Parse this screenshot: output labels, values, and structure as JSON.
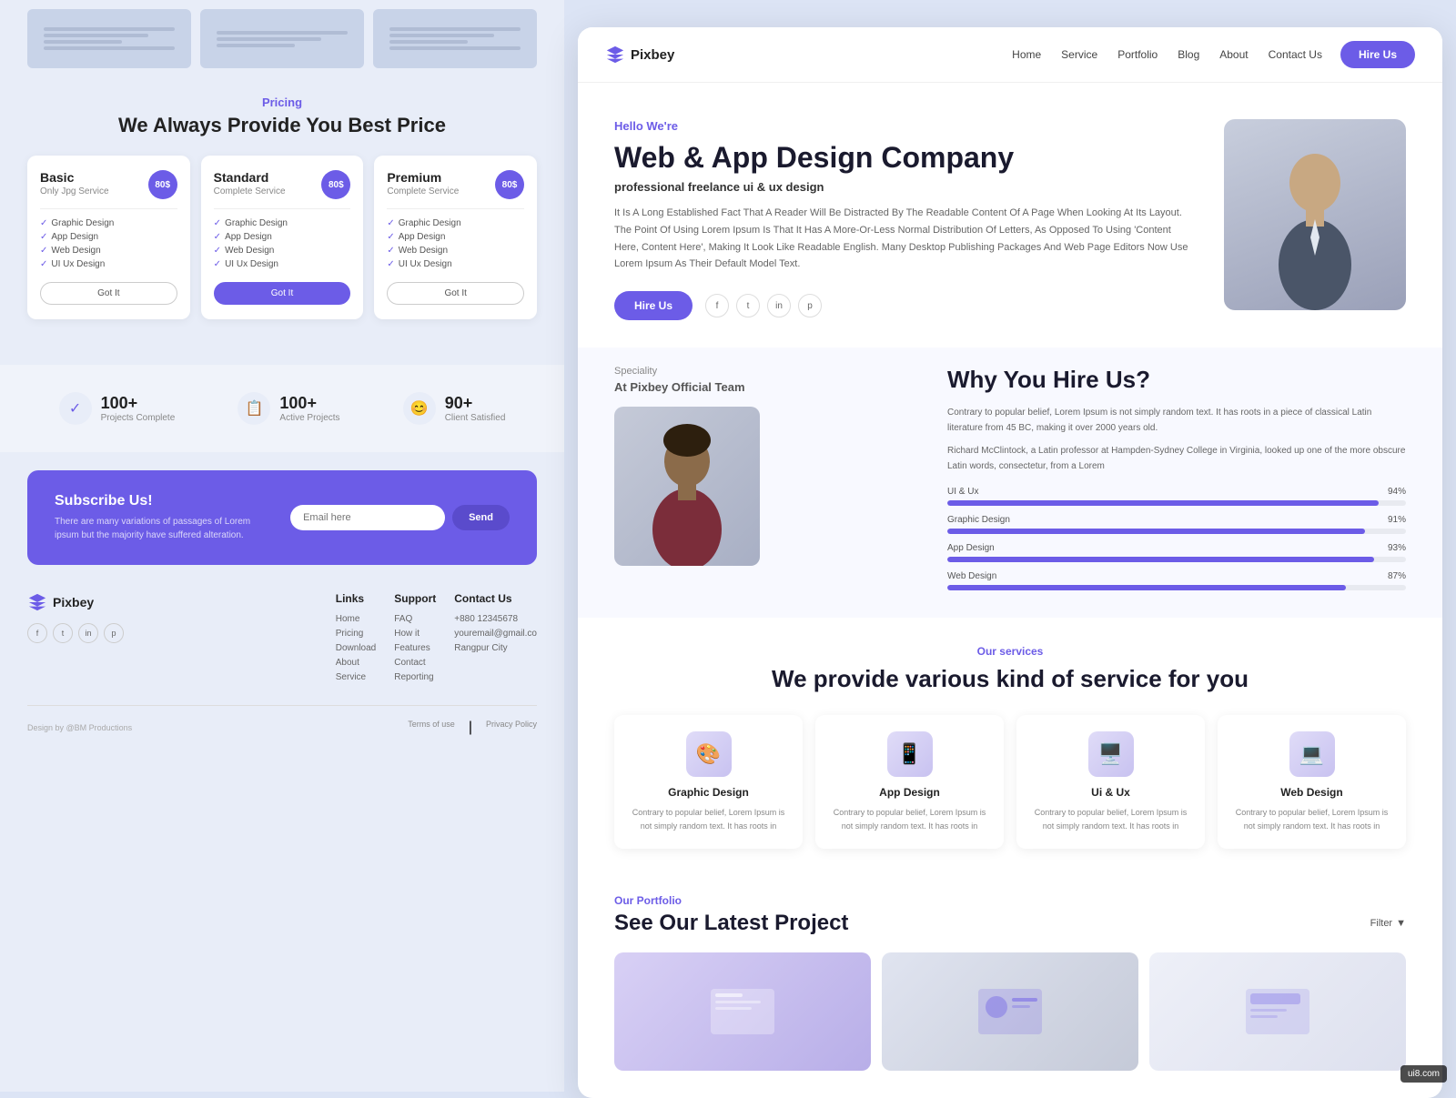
{
  "left": {
    "pricing": {
      "label": "Pricing",
      "title": "We Always Provide You Best Price",
      "cards": [
        {
          "plan": "Basic",
          "sub": "Only Jpg Service",
          "price": "80$",
          "features": [
            "Graphic Design",
            "App Design",
            "Web Design",
            "UI Ux Design"
          ],
          "btn": "Got It",
          "active": false
        },
        {
          "plan": "Standard",
          "sub": "Complete Service",
          "price": "80$",
          "features": [
            "Graphic Design",
            "App Design",
            "Web Design",
            "UI Ux Design"
          ],
          "btn": "Got It",
          "active": true
        },
        {
          "plan": "Premium",
          "sub": "Complete Service",
          "price": "80$",
          "features": [
            "Graphic Design",
            "App Design",
            "Web Design",
            "UI Ux Design"
          ],
          "btn": "Got It",
          "active": false
        }
      ]
    },
    "stats": [
      {
        "number": "100+",
        "label": "Projects Complete"
      },
      {
        "number": "100+",
        "label": "Active Projects"
      },
      {
        "number": "90+",
        "label": "Client Satisfied"
      }
    ],
    "subscribe": {
      "title": "Subscribe Us!",
      "desc": "There are many variations of passages of Lorem ipsum but the majority have suffered alteration.",
      "placeholder": "Email here",
      "btn": "Send"
    },
    "footer": {
      "logo": "Pixbey",
      "links": {
        "title": "Links",
        "items": [
          "Home",
          "Pricing",
          "Download",
          "About",
          "Service"
        ]
      },
      "support": {
        "title": "Support",
        "items": [
          "FAQ",
          "How it",
          "Features",
          "Contact",
          "Reporting"
        ]
      },
      "contact": {
        "title": "Contact Us",
        "items": [
          "+880 12345678",
          "youremail@gmail.co",
          "Rangpur City"
        ]
      },
      "bottom_left": "Design by @BM Productions",
      "terms": "Terms of use",
      "privacy": "Privacy Policy"
    }
  },
  "right": {
    "nav": {
      "logo": "Pixbey",
      "links": [
        "Home",
        "Service",
        "Portfolio",
        "Blog",
        "About",
        "Contact Us"
      ],
      "hire_btn": "Hire Us"
    },
    "hero": {
      "tag": "Hello We're",
      "title": "Web & App Design Company",
      "subtitle": "professional freelance ui & ux design",
      "desc": "It Is A Long Established Fact That A Reader Will Be Distracted By The Readable Content Of A Page When Looking At Its Layout. The Point Of Using Lorem Ipsum Is That It Has A More-Or-Less Normal Distribution Of Letters, As Opposed To Using 'Content Here, Content Here', Making It Look Like Readable English. Many Desktop Publishing Packages And Web Page Editors Now Use Lorem Ipsum As Their Default Model Text.",
      "btn": "Hire Us",
      "social": [
        "f",
        "t",
        "in",
        "p"
      ]
    },
    "speciality": {
      "label": "Speciality",
      "title": "At Pixbey Official Team"
    },
    "why": {
      "title": "Why You Hire Us?",
      "desc1": "Contrary to popular belief, Lorem Ipsum is not simply random text. It has roots in a piece of classical Latin literature from 45 BC, making it over 2000 years old.",
      "desc2": "Richard McClintock, a Latin professor at Hampden-Sydney College in Virginia, looked up one of the more obscure Latin words, consectetur, from a Lorem",
      "skills": [
        {
          "name": "UI & Ux",
          "pct": 94
        },
        {
          "name": "Graphic Design",
          "pct": 91
        },
        {
          "name": "App Design",
          "pct": 93
        },
        {
          "name": "Web Design",
          "pct": 87
        }
      ]
    },
    "services": {
      "tag": "Our services",
      "title": "We provide various kind of service for you",
      "cards": [
        {
          "name": "Graphic Design",
          "icon": "🎨",
          "desc": "Contrary to popular belief, Lorem Ipsum is not simply random text. It has roots in"
        },
        {
          "name": "App Design",
          "icon": "📱",
          "desc": "Contrary to popular belief, Lorem Ipsum is not simply random text. It has roots in"
        },
        {
          "name": "Ui & Ux",
          "icon": "🖥️",
          "desc": "Contrary to popular belief, Lorem Ipsum is not simply random text. It has roots in"
        },
        {
          "name": "Web Design",
          "icon": "💻",
          "desc": "Contrary to popular belief, Lorem Ipsum is not simply random text. It has roots in"
        }
      ]
    },
    "portfolio": {
      "tag": "Our Portfolio",
      "title": "See Our Latest Project",
      "filter": "Filter"
    },
    "watermark": "ui8.com"
  }
}
